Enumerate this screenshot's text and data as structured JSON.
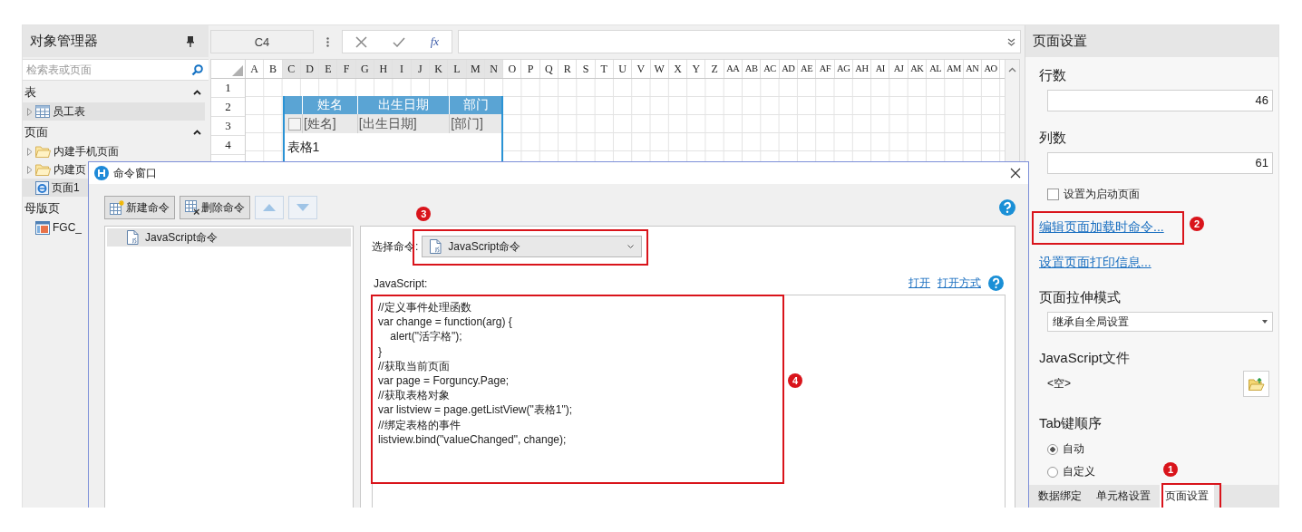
{
  "left_panel": {
    "title": "对象管理器",
    "search": {
      "placeholder": "检索表或页面"
    },
    "sections": [
      {
        "title": "表",
        "expanded": true,
        "items": [
          {
            "label": "员工表",
            "kind": "table",
            "expandable": true,
            "selected": true
          }
        ]
      },
      {
        "title": "页面",
        "expanded": true,
        "items": [
          {
            "label": "内建手机页面",
            "kind": "folder",
            "expandable": true,
            "selected": false
          },
          {
            "label": "内建页",
            "kind": "folder",
            "expandable": true,
            "selected": false
          },
          {
            "label": "页面1",
            "kind": "page",
            "expandable": false,
            "selected": true
          }
        ]
      },
      {
        "title": "母版页",
        "items": [
          {
            "label": "FGC_",
            "kind": "master",
            "expandable": false,
            "selected": false
          }
        ]
      }
    ]
  },
  "toolbar": {
    "name_box": "C4",
    "function_button": "fx"
  },
  "sheet": {
    "columns": [
      "A",
      "B",
      "C",
      "D",
      "E",
      "F",
      "G",
      "H",
      "I",
      "J",
      "K",
      "L",
      "M",
      "N",
      "O",
      "P",
      "Q",
      "R",
      "S",
      "T",
      "U",
      "V",
      "W",
      "X",
      "Y",
      "Z",
      "AA",
      "AB",
      "AC",
      "AD",
      "AE",
      "AF",
      "AG",
      "AH",
      "AI",
      "AJ",
      "AK",
      "AL",
      "AM",
      "AN",
      "AO"
    ],
    "rows": [
      "1",
      "2",
      "3",
      "4"
    ],
    "table": {
      "headers": [
        "姓名",
        "出生日期",
        "部门"
      ],
      "cells": [
        "[姓名]",
        "[出生日期]",
        "[部门]"
      ],
      "row_checked": false,
      "name": "表格1"
    }
  },
  "dialog": {
    "title": "命令窗口",
    "toolbar": [
      {
        "kind": "new",
        "label": "新建命令",
        "disabled": false
      },
      {
        "kind": "delete",
        "label": "删除命令",
        "disabled": false
      },
      {
        "kind": "up",
        "disabled": true
      },
      {
        "kind": "down",
        "disabled": true
      }
    ],
    "commands": [
      {
        "label": "JavaScript命令",
        "selected": true
      }
    ],
    "select_label": "选择命令:",
    "select_value": "JavaScript命令",
    "select_callout": "3",
    "editor_label": "JavaScript:",
    "links": [
      "打开",
      "打开方式"
    ],
    "code_lines": [
      "//定义事件处理函数",
      "var change = function(arg) {",
      "    alert(\"活字格\");",
      "}",
      "//获取当前页面",
      "var page = Forguncy.Page;",
      "//获取表格对象",
      "var listview = page.getListView(\"表格1\");",
      "//绑定表格的事件",
      "listview.bind(\"valueChanged\", change);"
    ],
    "code_callout": "4"
  },
  "right_panel": {
    "title": "页面设置",
    "rows_label": "行数",
    "rows_value": "46",
    "cols_label": "列数",
    "cols_value": "61",
    "startup": {
      "label": "设置为启动页面",
      "checked": false
    },
    "links": [
      {
        "label": "编辑页面加载时命令...",
        "callout": "2"
      },
      {
        "label": "设置页面打印信息..."
      }
    ],
    "stretch_label": "页面拉伸模式",
    "stretch_value": "继承自全局设置",
    "js_label": "JavaScript文件",
    "js_value": "<空>",
    "tab_label": "Tab键顺序",
    "tab_options": [
      {
        "label": "自动",
        "selected": true
      },
      {
        "label": "自定义",
        "selected": false
      }
    ],
    "tabs": [
      {
        "label": "数据绑定",
        "selected": false
      },
      {
        "label": "单元格设置",
        "selected": false
      },
      {
        "label": "页面设置",
        "selected": true,
        "callout": "1"
      }
    ]
  }
}
